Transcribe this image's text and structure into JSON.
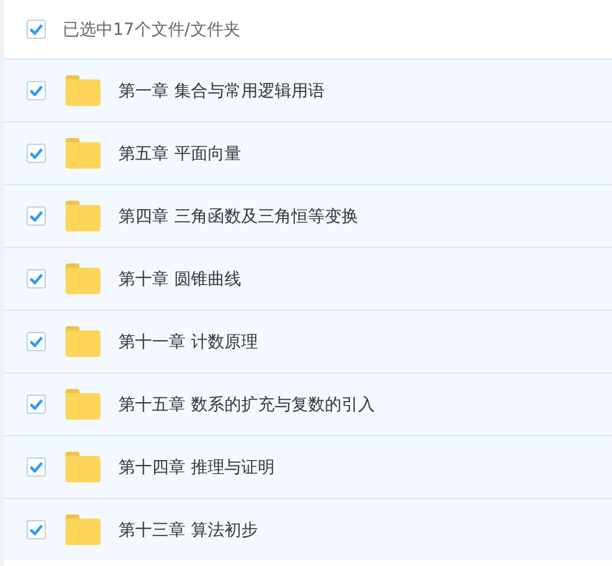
{
  "header": {
    "checked": true,
    "label": "已选中17个文件/文件夹"
  },
  "files": [
    {
      "name": "第一章 集合与常用逻辑用语",
      "checked": true
    },
    {
      "name": "第五章 平面向量",
      "checked": true
    },
    {
      "name": "第四章 三角函数及三角恒等变换",
      "checked": true
    },
    {
      "name": "第十章 圆锥曲线",
      "checked": true
    },
    {
      "name": "第十一章 计数原理",
      "checked": true
    },
    {
      "name": "第十五章 数系的扩充与复数的引入",
      "checked": true
    },
    {
      "name": "第十四章 推理与证明",
      "checked": true
    },
    {
      "name": "第十三章 算法初步",
      "checked": true
    }
  ]
}
